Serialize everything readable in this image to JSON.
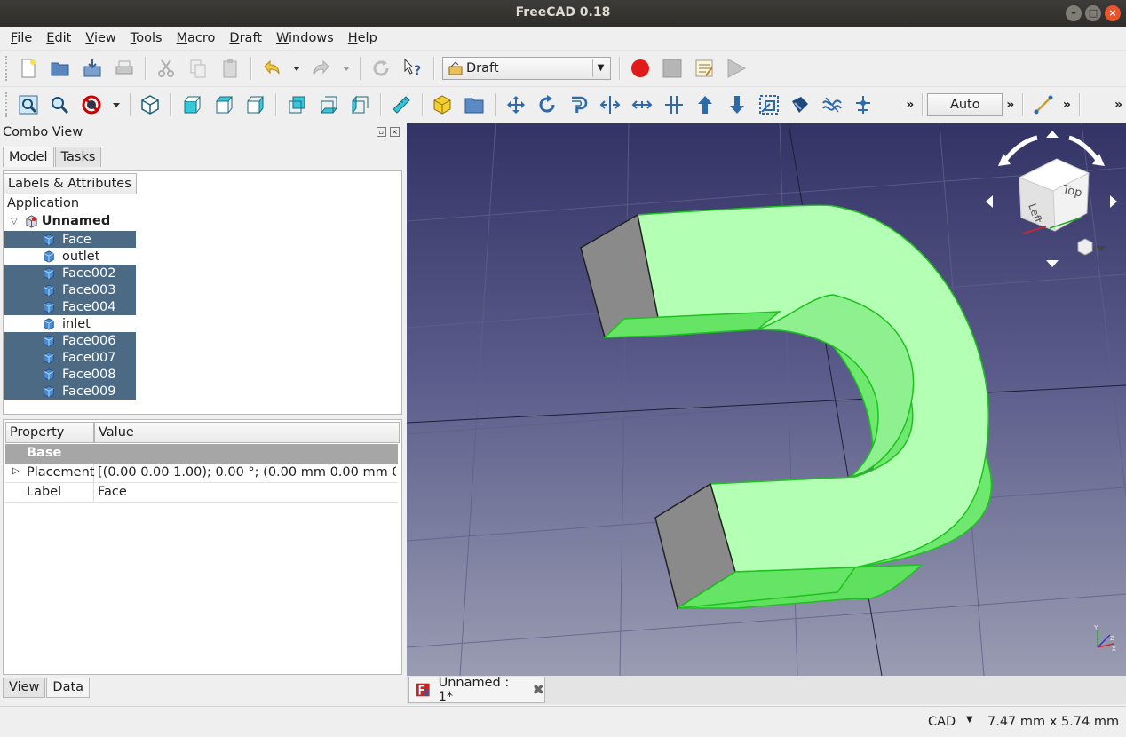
{
  "window": {
    "title": "FreeCAD 0.18",
    "controls": [
      "–",
      "□",
      "×"
    ]
  },
  "menu": [
    {
      "u": "F",
      "rest": "ile"
    },
    {
      "u": "E",
      "rest": "dit"
    },
    {
      "u": "V",
      "rest": "iew"
    },
    {
      "u": "T",
      "rest": "ools"
    },
    {
      "u": "M",
      "rest": "acro"
    },
    {
      "u": "D",
      "rest": "raft"
    },
    {
      "u": "W",
      "rest": "indows"
    },
    {
      "u": "H",
      "rest": "elp"
    }
  ],
  "toolbar1": {
    "workbench": "Draft",
    "dropdown_arrow": "▼"
  },
  "toolbar2": {
    "draw_style": "Auto",
    "overflow": "»"
  },
  "combo": {
    "title": "Combo View",
    "tabs": [
      "Model",
      "Tasks"
    ],
    "tree_header": "Labels & Attributes",
    "application": "Application",
    "document": "Unnamed",
    "items": [
      {
        "label": "Face",
        "selected": true
      },
      {
        "label": "outlet",
        "selected": false
      },
      {
        "label": "Face002",
        "selected": true
      },
      {
        "label": "Face003",
        "selected": true
      },
      {
        "label": "Face004",
        "selected": true
      },
      {
        "label": "inlet",
        "selected": false
      },
      {
        "label": "Face006",
        "selected": true
      },
      {
        "label": "Face007",
        "selected": true
      },
      {
        "label": "Face008",
        "selected": true
      },
      {
        "label": "Face009",
        "selected": true
      }
    ],
    "property_header": {
      "property": "Property",
      "value": "Value"
    },
    "group": "Base",
    "properties": [
      {
        "key": "Placement",
        "value": "[(0.00 0.00 1.00); 0.00 °; (0.00 mm  0.00 mm  0.0..."
      },
      {
        "key": "Label",
        "value": "Face"
      }
    ],
    "bottom_tabs": [
      "View",
      "Data"
    ]
  },
  "navcube": {
    "top": "Top",
    "left": "Left"
  },
  "axes": {
    "x": "X",
    "y": "Y",
    "z": "Z"
  },
  "doc_tab": {
    "label": "Unnamed : 1*"
  },
  "status": {
    "nav_style": "CAD",
    "dimensions": "7.47 mm x 5.74 mm"
  },
  "colors": {
    "selection": "#4d6a85",
    "shape_green": "#b3ffb3",
    "shape_edge": "#1ec21e"
  }
}
